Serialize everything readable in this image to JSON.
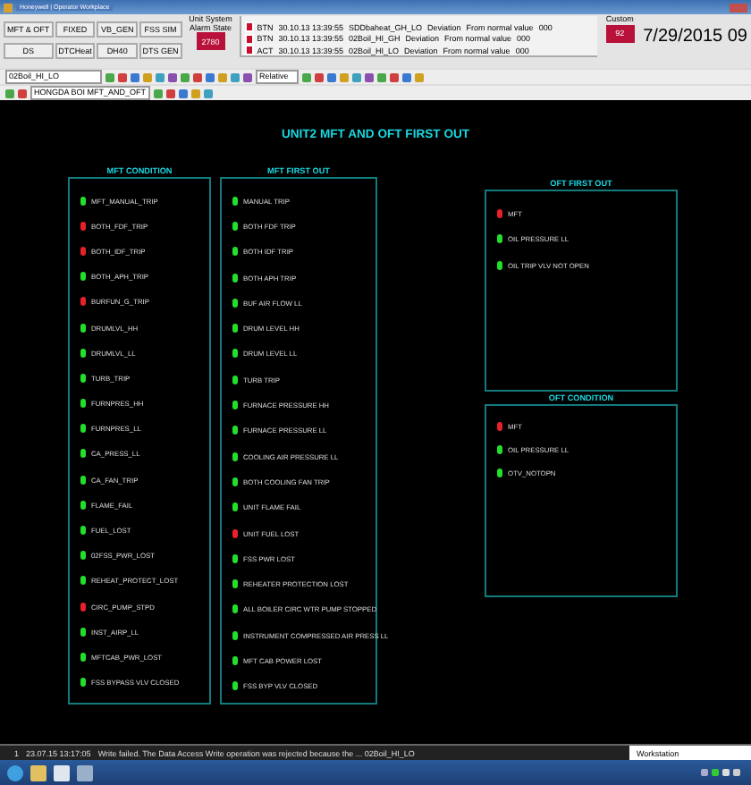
{
  "window": {
    "title": "Honeywell | Operator Workplace"
  },
  "header": {
    "buttons": [
      {
        "label": "MFT & OFT"
      },
      {
        "label": "FIXED"
      },
      {
        "label": "VB_GEN"
      },
      {
        "label": "FSS SIM"
      },
      {
        "label": "DS"
      },
      {
        "label": "DTCHeat"
      },
      {
        "label": "DH40"
      },
      {
        "label": "DTS GEN"
      }
    ],
    "system_box": {
      "label": "Unit System Alarm State",
      "value": "2780"
    },
    "alarms": [
      {
        "type": "BTN",
        "time": "30.10.13 13:39:55",
        "point": "SDDbaheat_GH_LO",
        "condition": "Deviation",
        "description": "From normal value",
        "value": "000"
      },
      {
        "type": "BTN",
        "time": "30.10.13 13:39:55",
        "point": "02Boil_HI_GH",
        "condition": "Deviation",
        "description": "From normal value",
        "value": "000"
      },
      {
        "type": "ACT",
        "time": "30.10.13 13:39:55",
        "point": "02Boil_HI_LO",
        "condition": "Deviation",
        "description": "From normal value",
        "value": "000"
      }
    ],
    "custom_box": {
      "label": "Custom",
      "value": "92"
    },
    "clock": "7/29/2015 09"
  },
  "toolbar": {
    "point_field": "02Boil_HI_LO",
    "zoom_field": "Relative",
    "display_field": "HONGDA BOI MFT_AND_OFT"
  },
  "display": {
    "title": "UNIT2 MFT AND OFT FIRST OUT",
    "panels": [
      {
        "heading": "MFT CONDITION",
        "items": [
          {
            "label": "MFT_MANUAL_TRIP",
            "alarm": false
          },
          {
            "label": "BOTH_FDF_TRIP",
            "alarm": true
          },
          {
            "label": "BOTH_IDF_TRIP",
            "alarm": true
          },
          {
            "label": "BOTH_APH_TRIP",
            "alarm": false
          },
          {
            "label": "BURFUN_G_TRIP",
            "alarm": true
          },
          {
            "label": "DRUMLVL_HH",
            "alarm": false
          },
          {
            "label": "DRUMLVL_LL",
            "alarm": false
          },
          {
            "label": "TURB_TRIP",
            "alarm": false
          },
          {
            "label": "FURNPRES_HH",
            "alarm": false
          },
          {
            "label": "FURNPRES_LL",
            "alarm": false
          },
          {
            "label": "CA_PRESS_LL",
            "alarm": false
          },
          {
            "label": "CA_FAN_TRIP",
            "alarm": false
          },
          {
            "label": "FLAME_FAIL",
            "alarm": false
          },
          {
            "label": "FUEL_LOST",
            "alarm": false
          },
          {
            "label": "02FSS_PWR_LOST",
            "alarm": false
          },
          {
            "label": "REHEAT_PROTECT_LOST",
            "alarm": false
          },
          {
            "label": "CIRC_PUMP_STPD",
            "alarm": true
          },
          {
            "label": "INST_AIRP_LL",
            "alarm": false
          },
          {
            "label": "MFTCAB_PWR_LOST",
            "alarm": false
          },
          {
            "label": "FSS BYPASS VLV CLOSED",
            "alarm": false
          }
        ]
      },
      {
        "heading": "MFT FIRST OUT",
        "items": [
          {
            "label": "MANUAL TRIP",
            "alarm": false
          },
          {
            "label": "BOTH FDF TRIP",
            "alarm": false
          },
          {
            "label": "BOTH IDF TRIP",
            "alarm": false
          },
          {
            "label": "BOTH APH TRIP",
            "alarm": false
          },
          {
            "label": "BUF AIR FLOW LL",
            "alarm": false
          },
          {
            "label": "DRUM LEVEL HH",
            "alarm": false
          },
          {
            "label": "DRUM LEVEL LL",
            "alarm": false
          },
          {
            "label": "TURB TRIP",
            "alarm": false
          },
          {
            "label": "FURNACE PRESSURE HH",
            "alarm": false
          },
          {
            "label": "FURNACE PRESSURE LL",
            "alarm": false
          },
          {
            "label": "COOLING AIR PRESSURE LL",
            "alarm": false
          },
          {
            "label": "BOTH COOLING FAN TRIP",
            "alarm": false
          },
          {
            "label": "UNIT FLAME FAIL",
            "alarm": false
          },
          {
            "label": "UNIT FUEL LOST",
            "alarm": true
          },
          {
            "label": "FSS PWR LOST",
            "alarm": false
          },
          {
            "label": "REHEATER PROTECTION LOST",
            "alarm": false
          },
          {
            "label": "ALL BOILER CIRC WTR PUMP STOPPED",
            "alarm": false
          },
          {
            "label": "INSTRUMENT COMPRESSED AIR PRESS LL",
            "alarm": false
          },
          {
            "label": "MFT CAB POWER LOST",
            "alarm": false
          },
          {
            "label": "FSS BYP VLV CLOSED",
            "alarm": false
          }
        ]
      },
      {
        "heading": "OFT FIRST OUT",
        "items": [
          {
            "label": "MFT",
            "alarm": true
          },
          {
            "label": "OIL PRESSURE LL",
            "alarm": false
          },
          {
            "label": "OIL TRIP VLV NOT OPEN",
            "alarm": false
          }
        ]
      },
      {
        "heading": "OFT CONDITION",
        "items": [
          {
            "label": "MFT",
            "alarm": true
          },
          {
            "label": "OIL PRESSURE LL",
            "alarm": false
          },
          {
            "label": "OTV_NOTOPN",
            "alarm": false
          }
        ]
      }
    ]
  },
  "status_bar": {
    "count": "1",
    "time": "23.07.15 13:17:05",
    "message": "Write failed. The Data Access Write operation was rejected because the ... 02Boil_HI_LO",
    "station": "Workstation"
  }
}
